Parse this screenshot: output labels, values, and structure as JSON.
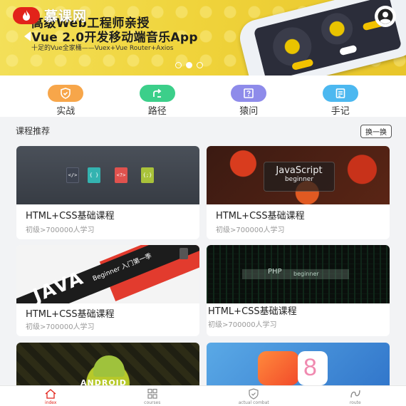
{
  "app": {
    "logo_text": "慕课网"
  },
  "banner": {
    "line1": "高级Web工程师亲授",
    "line2": "Vue 2.0开发移动端音乐App",
    "subtitle": "十足的Vue全家桶——Vuex+Vue Router+Axios",
    "slide_count": 3,
    "active_slide": 2
  },
  "quicknav": [
    {
      "label": "实战",
      "icon": "shield-icon",
      "color": "#f7a64a"
    },
    {
      "label": "路径",
      "icon": "path-arrows-icon",
      "color": "#3ccf8a"
    },
    {
      "label": "猿问",
      "icon": "question-icon",
      "color": "#8e8bea"
    },
    {
      "label": "手记",
      "icon": "notes-icon",
      "color": "#4cb8f0"
    }
  ],
  "section": {
    "title": "课程推荐",
    "refresh_label": "换一换"
  },
  "courses": [
    {
      "title": "HTML+CSS基础课程",
      "meta": "初级>700000人学习",
      "image": "html-files"
    },
    {
      "title": "HTML+CSS基础课程",
      "meta": "初级>700000人学习",
      "image": "javascript-beginner",
      "image_text": "JavaScript",
      "image_sub": "beginner"
    },
    {
      "title": "HTML+CSS基础课程",
      "meta": "初级>700000人学习",
      "image": "java-beginner",
      "image_text": "JAVA",
      "image_sub": "Beginner 入门第一季"
    },
    {
      "title": "HTML+CSS基础课程",
      "meta": "初级>700000人学习",
      "image": "php-beginner",
      "image_text": "PHP",
      "image_sub": "beginner"
    },
    {
      "title": "",
      "meta": "",
      "image": "android",
      "image_text": "ANDROID"
    },
    {
      "title": "",
      "meta": "",
      "image": "swift"
    }
  ],
  "tabs": [
    {
      "label": "index",
      "icon": "home-icon",
      "active": true
    },
    {
      "label": "courses",
      "icon": "grid-icon",
      "active": false
    },
    {
      "label": "actual combat",
      "icon": "shield-icon",
      "active": false
    },
    {
      "label": "route",
      "icon": "route-icon",
      "active": false
    }
  ]
}
